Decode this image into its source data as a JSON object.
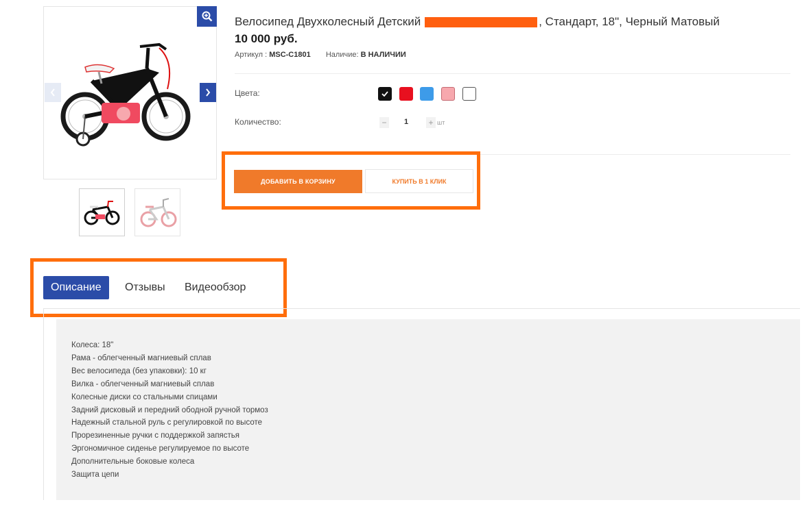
{
  "product": {
    "title_before": "Велосипед Двухколесный Детский",
    "title_after": ", Стандарт, 18\", Черный Матовый",
    "price": "10 000 руб.",
    "sku_label": "Артикул :",
    "sku": "MSC-C1801",
    "availability_label": "Наличие:",
    "availability": "В НАЛИЧИИ"
  },
  "options": {
    "colors_label": "Цвета:",
    "colors": [
      {
        "name": "black",
        "hex": "#111111",
        "selected": true
      },
      {
        "name": "red",
        "hex": "#e8101f",
        "selected": false
      },
      {
        "name": "blue",
        "hex": "#3d9be9",
        "selected": false
      },
      {
        "name": "pink",
        "hex": "#f7a8ae",
        "selected": false
      },
      {
        "name": "white",
        "hex": "#ffffff",
        "selected": false
      }
    ],
    "quantity_label": "Количество:",
    "quantity": "1",
    "unit": "шт"
  },
  "actions": {
    "add_to_cart": "ДОБАВИТЬ В КОРЗИНУ",
    "buy_one_click": "КУПИТЬ В 1 КЛИК"
  },
  "tabs": [
    {
      "label": "Описание",
      "active": true
    },
    {
      "label": "Отзывы",
      "active": false
    },
    {
      "label": "Видеообзор",
      "active": false
    }
  ],
  "description": [
    "Колеса: 18\"",
    "Рама - облегченный магниевый сплав",
    "Вес велосипеда (без упаковки):  10 кг",
    "Вилка - облегченный магниевый сплав",
    "Колесные диски со стальными спицами",
    "Задний дисковый и передний ободной ручной тормоз",
    "Надежный стальной руль с регулировкой по высоте",
    "Прорезиненные ручки с поддержкой запястья",
    "Эргономичное сиденье регулируемое по высоте",
    "Дополнительные боковые колеса",
    "Защита цепи"
  ],
  "colors": {
    "accent": "#2b4ca8",
    "button_orange": "#f07a2a",
    "highlight": "#ff6e0c",
    "redaction": "#ff5f0f"
  },
  "icons": {
    "zoom": "zoom-in-icon",
    "prev": "chevron-left-icon",
    "next": "chevron-right-icon",
    "check": "check-icon"
  }
}
